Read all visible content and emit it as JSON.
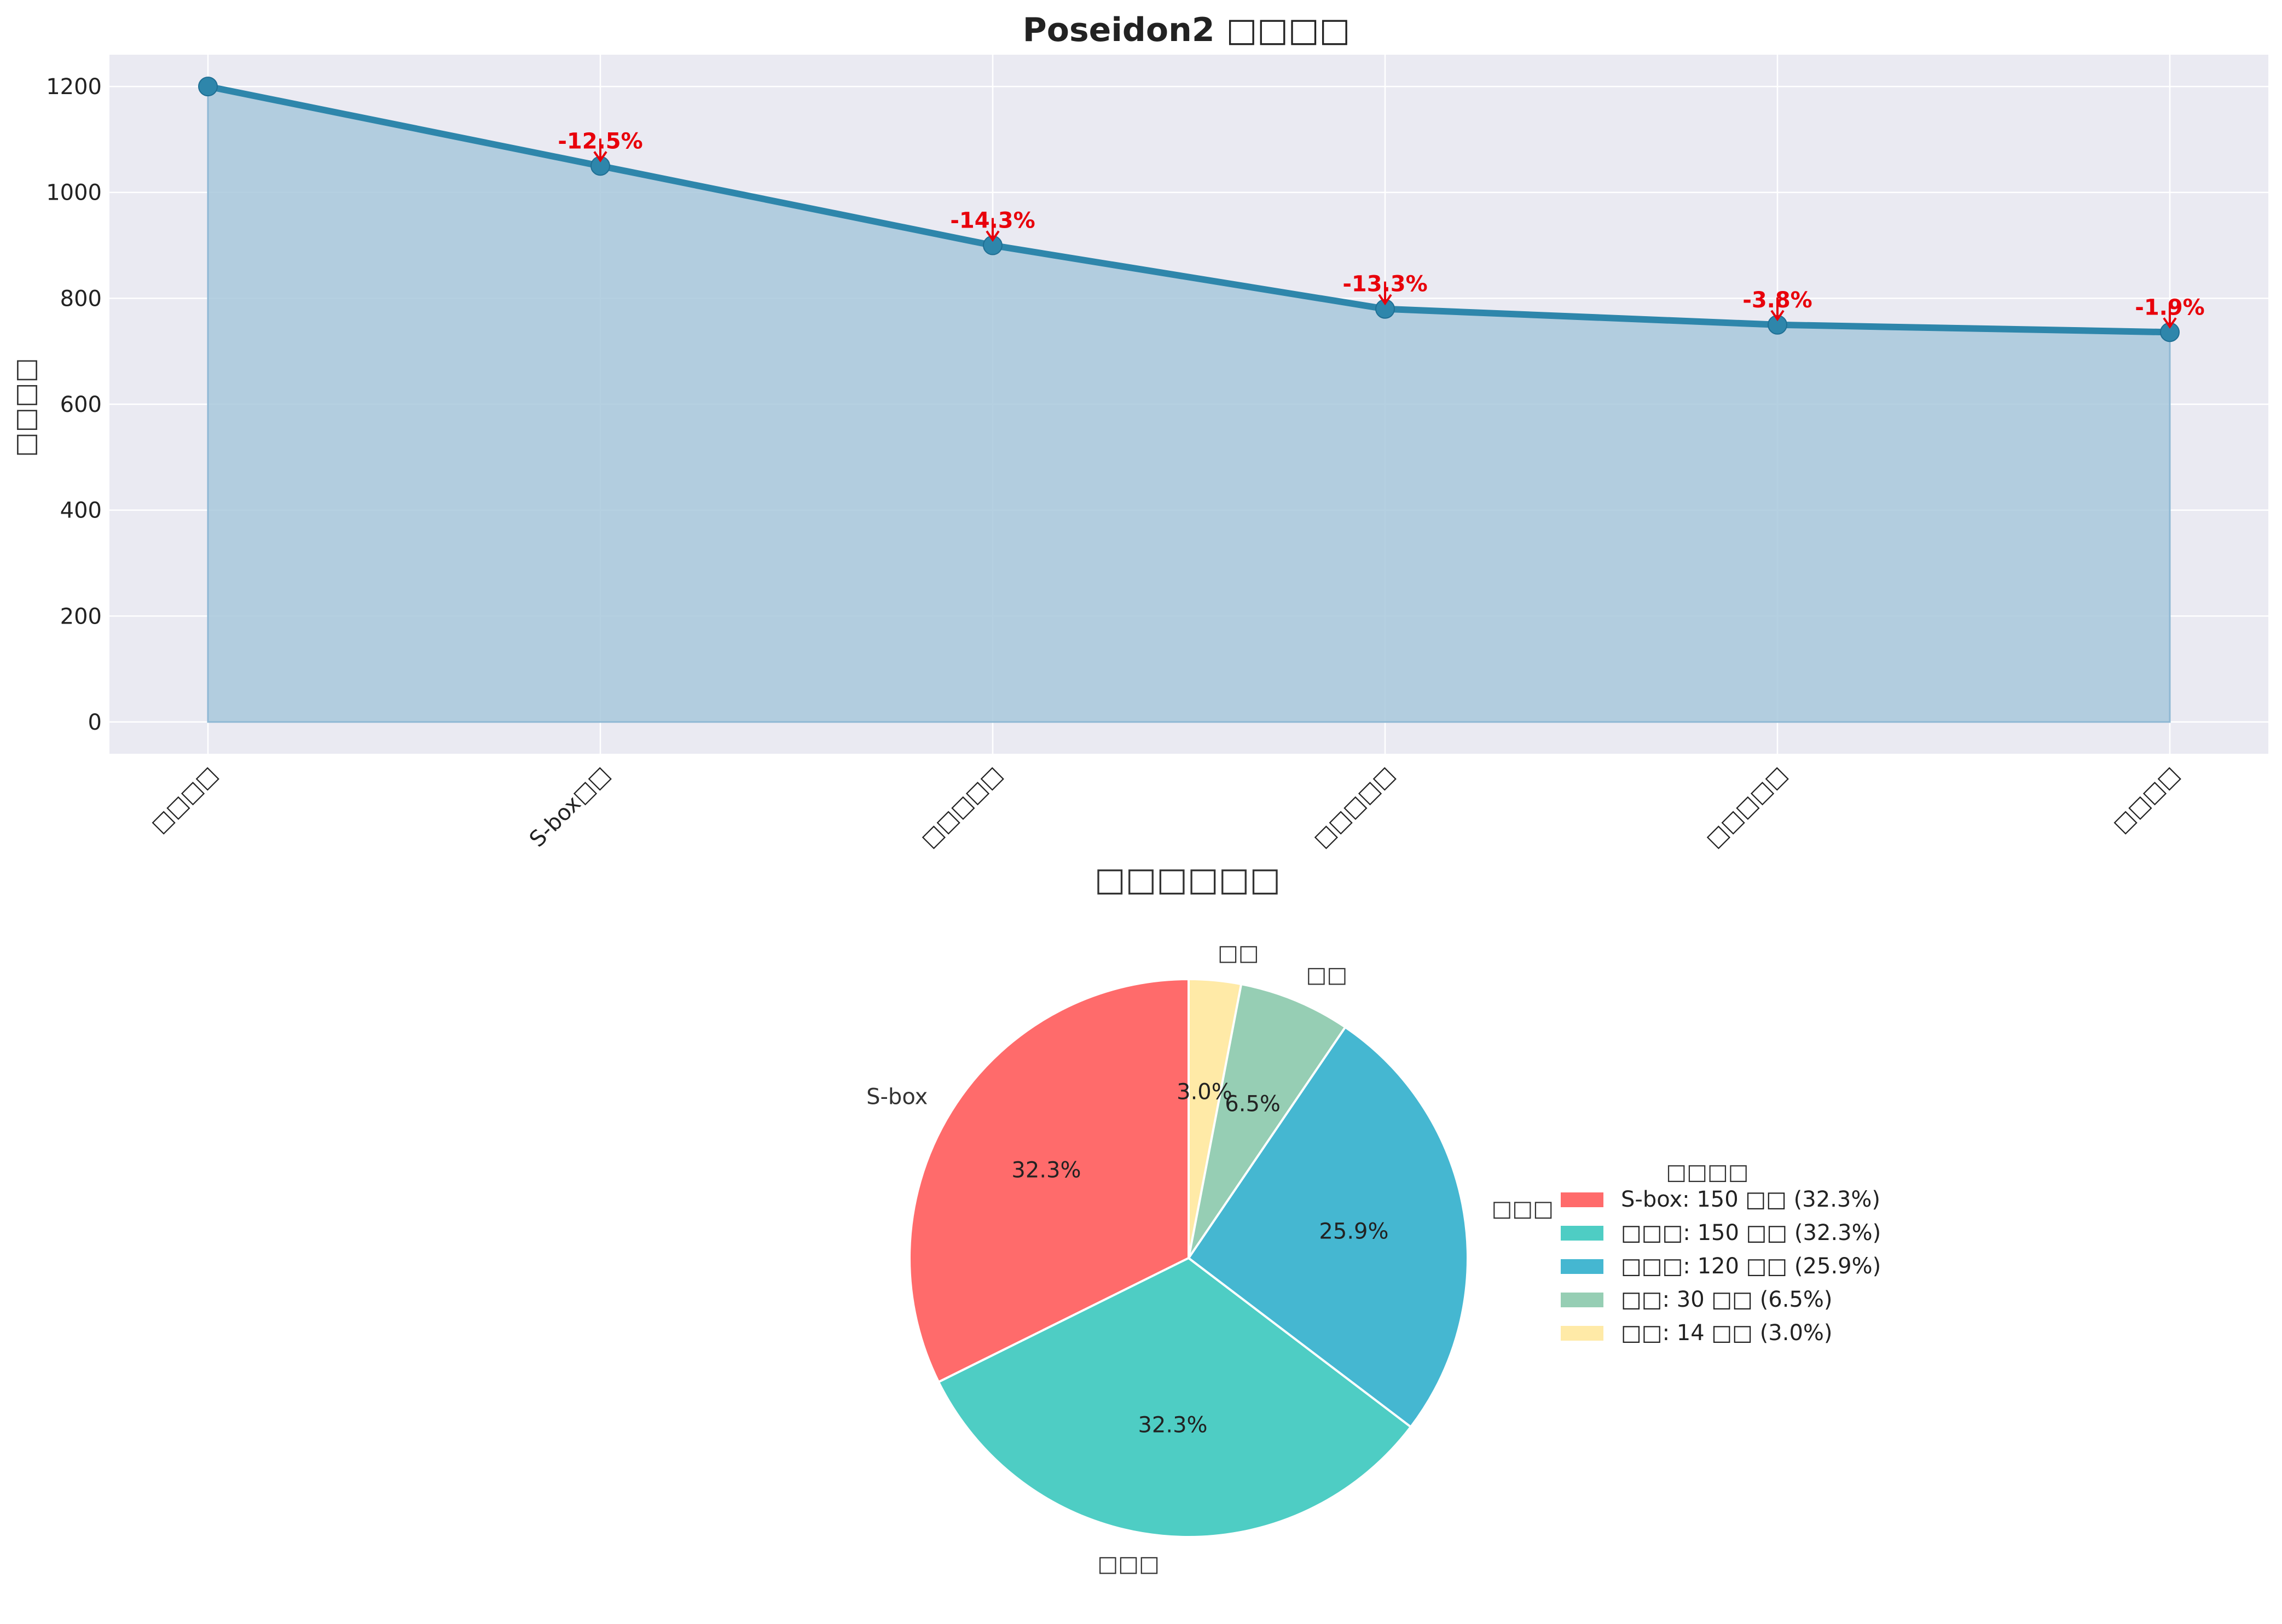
{
  "chart_data": [
    {
      "type": "area",
      "title": "Poseidon2 □□□□",
      "xlabel": "",
      "ylabel": "□□□□",
      "categories": [
        "□□□□",
        "S-box□□",
        "□□□□□",
        "□□□□□",
        "□□□□□",
        "□□□□"
      ],
      "values": [
        1200,
        1050,
        900,
        780,
        750,
        736
      ],
      "annotations": [
        "",
        "-12.5%",
        "-14.3%",
        "-13.3%",
        "-3.8%",
        "-1.9%"
      ],
      "yticks": [
        0,
        200,
        400,
        600,
        800,
        1000,
        1200
      ],
      "ylim": [
        -60,
        1260
      ],
      "grid": true,
      "colors": {
        "line": "#2e86ab",
        "fill": "#a8c8dc",
        "annotation": "#e8000b",
        "background": "#eaeaf2"
      }
    },
    {
      "type": "pie",
      "title": "□□□□□□",
      "slices": [
        {
          "label": "S-box",
          "value": 150,
          "pct": "32.3%",
          "color": "#ff6b6b"
        },
        {
          "label": "□□□",
          "value": 150,
          "pct": "32.3%",
          "color": "#4ecdc4"
        },
        {
          "label": "□□□",
          "value": 120,
          "pct": "25.9%",
          "color": "#45b7d1"
        },
        {
          "label": "□□",
          "value": 30,
          "pct": "6.5%",
          "color": "#96ceb4"
        },
        {
          "label": "□□",
          "value": 14,
          "pct": "3.0%",
          "color": "#ffeaa7"
        }
      ],
      "legend": {
        "title": "□□□□",
        "placement": "right",
        "entries": [
          "S-box: 150 □□ (32.3%)",
          "□□□: 150 □□ (32.3%)",
          "□□□: 120 □□ (25.9%)",
          "□□: 30 □□ (6.5%)",
          "□□: 14 □□ (3.0%)"
        ]
      }
    }
  ]
}
